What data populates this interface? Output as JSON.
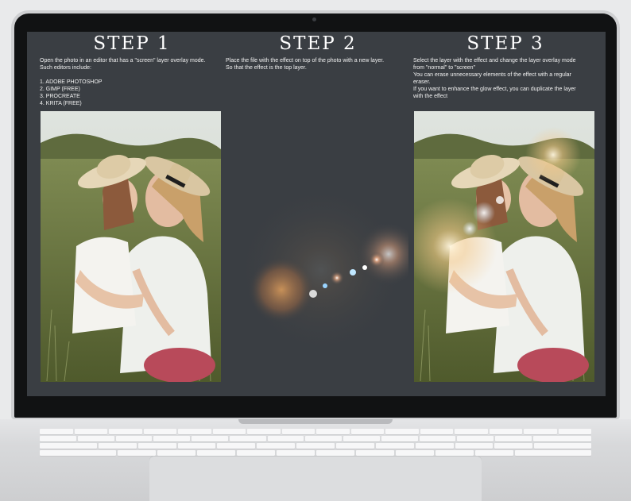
{
  "steps": [
    {
      "title": "STEP 1",
      "text": "Open the photo in an editor that has a \"screen\" layer overlay mode.\nSuch editors include:\n\n1. ADOBE PHOTOSHOP\n2. GIMP (FREE)\n3. PROCREATE\n4. KRITA (FREE)"
    },
    {
      "title": "STEP 2",
      "text": "Place the file with the effect on top of the photo with a new layer.\nSo that the effect is the top layer."
    },
    {
      "title": "STEP 3",
      "text": "Select the layer with the effect and change the layer overlay mode\nfrom \"normal\" to \"screen\"\nYou can erase unnecessary elements of the effect with a regular\neraser.\nIf you want to enhance the glow effect, you can duplicate the layer\nwith the effect"
    }
  ],
  "images": {
    "before_photo": "mother-and-daughter-in-meadow-photo",
    "effect": "lens-flare-effect",
    "after_photo": "mother-and-daughter-with-flare-photo"
  },
  "colors": {
    "screen_bg": "#3a3e43",
    "bezel": "#111213",
    "laptop_body": "#d8d9db"
  }
}
